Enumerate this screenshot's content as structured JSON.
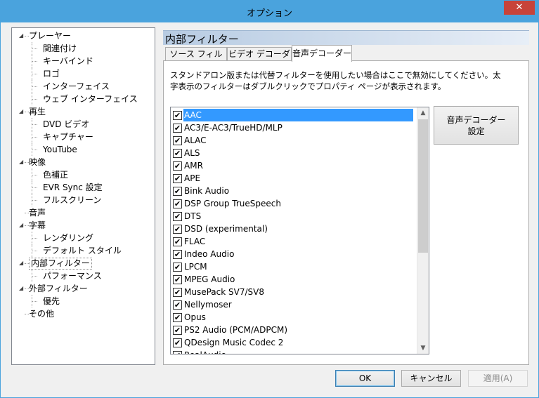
{
  "window": {
    "title": "オプション",
    "close_glyph": "✕"
  },
  "tree": {
    "items": [
      {
        "label": "プレーヤー",
        "level": 0,
        "expander": "◢"
      },
      {
        "label": "関連付け",
        "level": 1
      },
      {
        "label": "キーバインド",
        "level": 1
      },
      {
        "label": "ロゴ",
        "level": 1
      },
      {
        "label": "インターフェイス",
        "level": 1
      },
      {
        "label": "ウェブ インターフェイス",
        "level": 1
      },
      {
        "label": "再生",
        "level": 0,
        "expander": "◢"
      },
      {
        "label": "DVD ビデオ",
        "level": 1
      },
      {
        "label": "キャプチャー",
        "level": 1
      },
      {
        "label": "YouTube",
        "level": 1
      },
      {
        "label": "映像",
        "level": 0,
        "expander": "◢"
      },
      {
        "label": "色補正",
        "level": 1
      },
      {
        "label": "EVR Sync 設定",
        "level": 1
      },
      {
        "label": "フルスクリーン",
        "level": 1
      },
      {
        "label": "音声",
        "level": 0
      },
      {
        "label": "字幕",
        "level": 0,
        "expander": "◢"
      },
      {
        "label": "レンダリング",
        "level": 1
      },
      {
        "label": "デフォルト スタイル",
        "level": 1
      },
      {
        "label": "内部フィルター",
        "level": 0,
        "expander": "◢",
        "selected": true
      },
      {
        "label": "パフォーマンス",
        "level": 1
      },
      {
        "label": "外部フィルター",
        "level": 0,
        "expander": "◢"
      },
      {
        "label": "優先",
        "level": 1
      },
      {
        "label": "その他",
        "level": 0
      }
    ]
  },
  "panel": {
    "title": "内部フィルター",
    "tabs": [
      {
        "label": "ソース フィルター",
        "active": false
      },
      {
        "label": "ビデオ デコーダー",
        "active": false
      },
      {
        "label": "音声デコーダー",
        "active": true
      }
    ],
    "description": "スタンドアロン版または代替フィルターを使用したい場合はここで無効にしてください。太字表示のフィルターはダブルクリックでプロパティ ページが表示されます。",
    "list": [
      {
        "label": "AAC",
        "checked": true,
        "selected": true
      },
      {
        "label": "AC3/E-AC3/TrueHD/MLP",
        "checked": true
      },
      {
        "label": "ALAC",
        "checked": true
      },
      {
        "label": "ALS",
        "checked": true
      },
      {
        "label": "AMR",
        "checked": true
      },
      {
        "label": "APE",
        "checked": true
      },
      {
        "label": "Bink Audio",
        "checked": true
      },
      {
        "label": "DSP Group TrueSpeech",
        "checked": true
      },
      {
        "label": "DTS",
        "checked": true
      },
      {
        "label": "DSD (experimental)",
        "checked": true
      },
      {
        "label": "FLAC",
        "checked": true
      },
      {
        "label": "Indeo Audio",
        "checked": true
      },
      {
        "label": "LPCM",
        "checked": true
      },
      {
        "label": "MPEG Audio",
        "checked": true
      },
      {
        "label": "MusePack SV7/SV8",
        "checked": true
      },
      {
        "label": "Nellymoser",
        "checked": true
      },
      {
        "label": "Opus",
        "checked": true
      },
      {
        "label": "PS2 Audio (PCM/ADPCM)",
        "checked": true
      },
      {
        "label": "QDesign Music Codec 2",
        "checked": true
      },
      {
        "label": "RealAudio",
        "checked": true
      }
    ],
    "check_glyph": "✔",
    "scroll_up_glyph": "▲",
    "scroll_down_glyph": "▼",
    "settings_button_line1": "音声デコーダー",
    "settings_button_line2": "設定"
  },
  "buttons": {
    "ok": "OK",
    "cancel": "キャンセル",
    "apply": "適用(A)"
  }
}
